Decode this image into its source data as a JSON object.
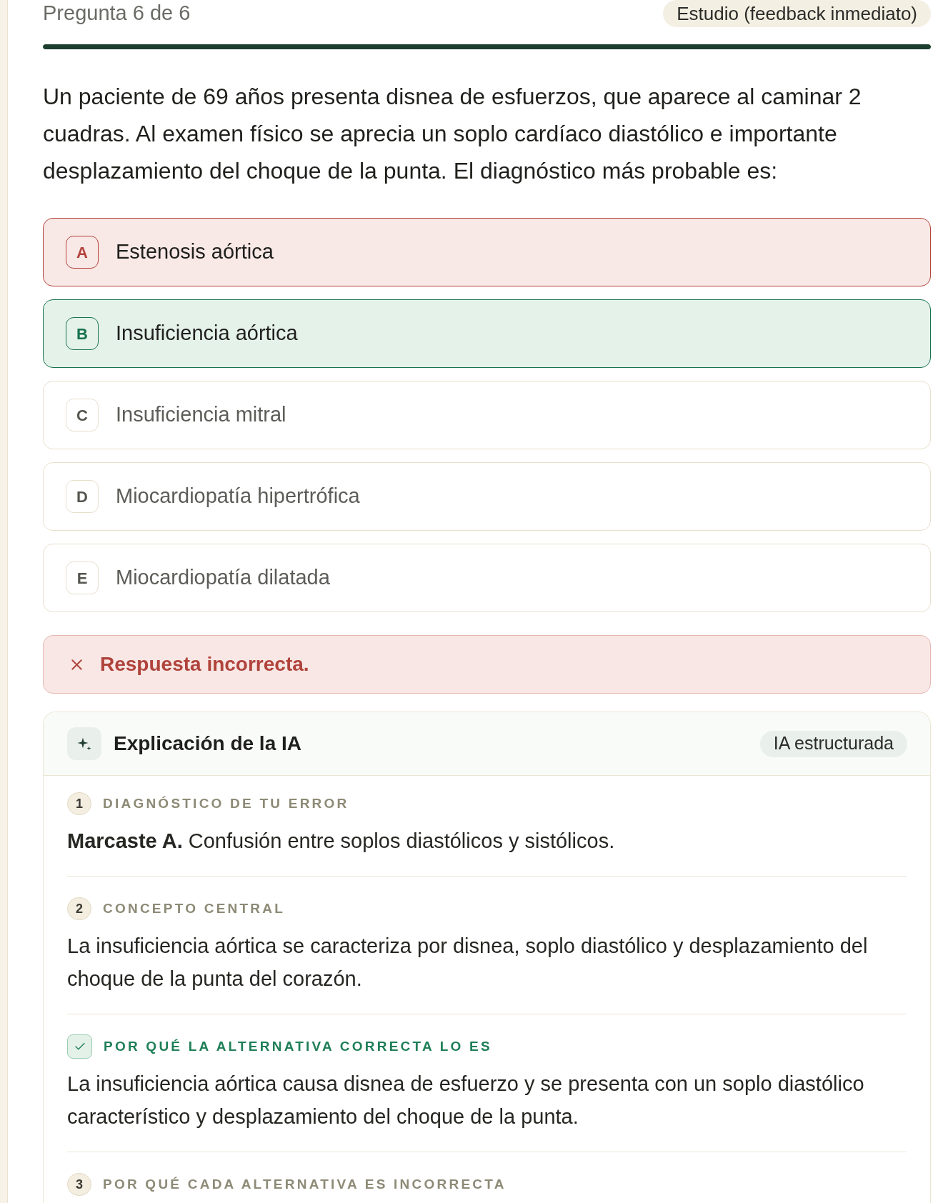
{
  "progress": {
    "label": "Pregunta 6 de 6",
    "level": 1
  },
  "mode": "Estudio (feedback inmediato)",
  "question": "Un paciente de 69 años presenta disnea de esfuerzos, que aparece al caminar 2 cuadras. Al examen físico se aprecia un soplo cardíaco diastólico e importante desplazamiento del choque de la punta. El diagnóstico más probable es:",
  "options": [
    {
      "letter": "A",
      "text": "Estenosis aórtica",
      "selected": true,
      "correct": false
    },
    {
      "letter": "B",
      "text": "Insuficiencia aórtica",
      "selected": false,
      "correct": true
    },
    {
      "letter": "C",
      "text": "Insuficiencia mitral",
      "selected": false,
      "correct": false
    },
    {
      "letter": "D",
      "text": "Miocardiopatía hipertrófica",
      "selected": false,
      "correct": false
    },
    {
      "letter": "E",
      "text": "Miocardiopatía dilatada",
      "selected": false,
      "correct": false
    }
  ],
  "feedback": {
    "correct": false,
    "text": "Respuesta incorrecta."
  },
  "explanation": {
    "title": "Explicación de la IA",
    "tag": "IA estructurada",
    "sections": [
      {
        "kind": "number",
        "marker": "1",
        "label": "DIAGNÓSTICO DE TU ERROR",
        "text": "**Marcaste A.** Confusión entre soplos diastólicos y sistólicos."
      },
      {
        "kind": "number",
        "marker": "2",
        "label": "CONCEPTO CENTRAL",
        "text": "La insuficiencia aórtica se caracteriza por disnea, soplo diastólico y desplazamiento del choque de la punta del corazón."
      },
      {
        "kind": "check",
        "label": "POR QUÉ LA ALTERNATIVA CORRECTA LO ES",
        "text": "La insuficiencia aórtica causa disnea de esfuerzo y se presenta con un soplo diastólico característico y desplazamiento del choque de la punta."
      },
      {
        "kind": "number",
        "marker": "3",
        "label": "POR QUÉ CADA ALTERNATIVA ES INCORRECTA"
      }
    ]
  }
}
